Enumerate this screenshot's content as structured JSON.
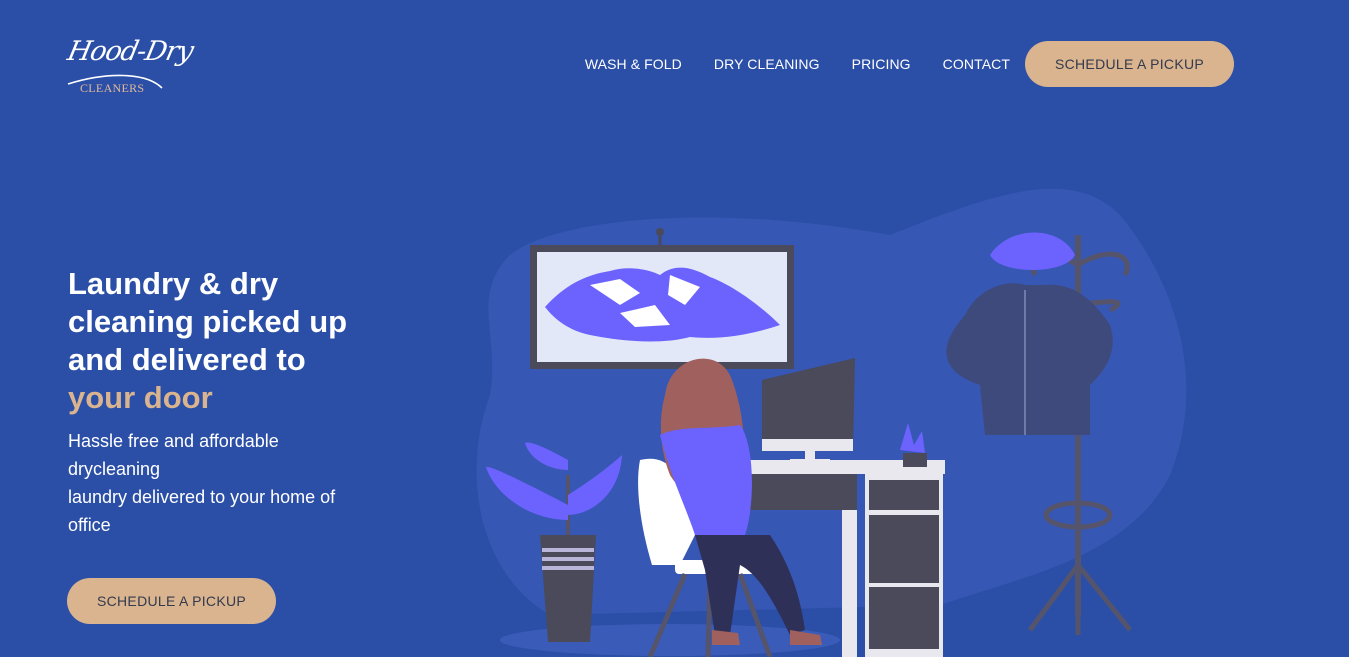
{
  "logo": {
    "script": "Hood-Dry",
    "subtitle": "CLEANERS"
  },
  "nav": {
    "items": [
      {
        "label": "WASH & FOLD"
      },
      {
        "label": "DRY CLEANING"
      },
      {
        "label": "PRICING"
      },
      {
        "label": "CONTACT"
      }
    ],
    "cta": "SCHEDULE A PICKUP"
  },
  "hero": {
    "title_line1": "Laundry & dry",
    "title_line2": "cleaning picked up",
    "title_line3": "and delivered to",
    "title_accent": "your door",
    "desc_line1": "Hassle free and affordable",
    "desc_line2": "drycleaning",
    "desc_line3": "laundry delivered to your home of",
    "desc_line4": "office",
    "cta": "SCHEDULE A PICKUP"
  },
  "colors": {
    "background": "#2b4fa7",
    "accent": "#d9b48f",
    "illustration_purple": "#6c63ff"
  }
}
